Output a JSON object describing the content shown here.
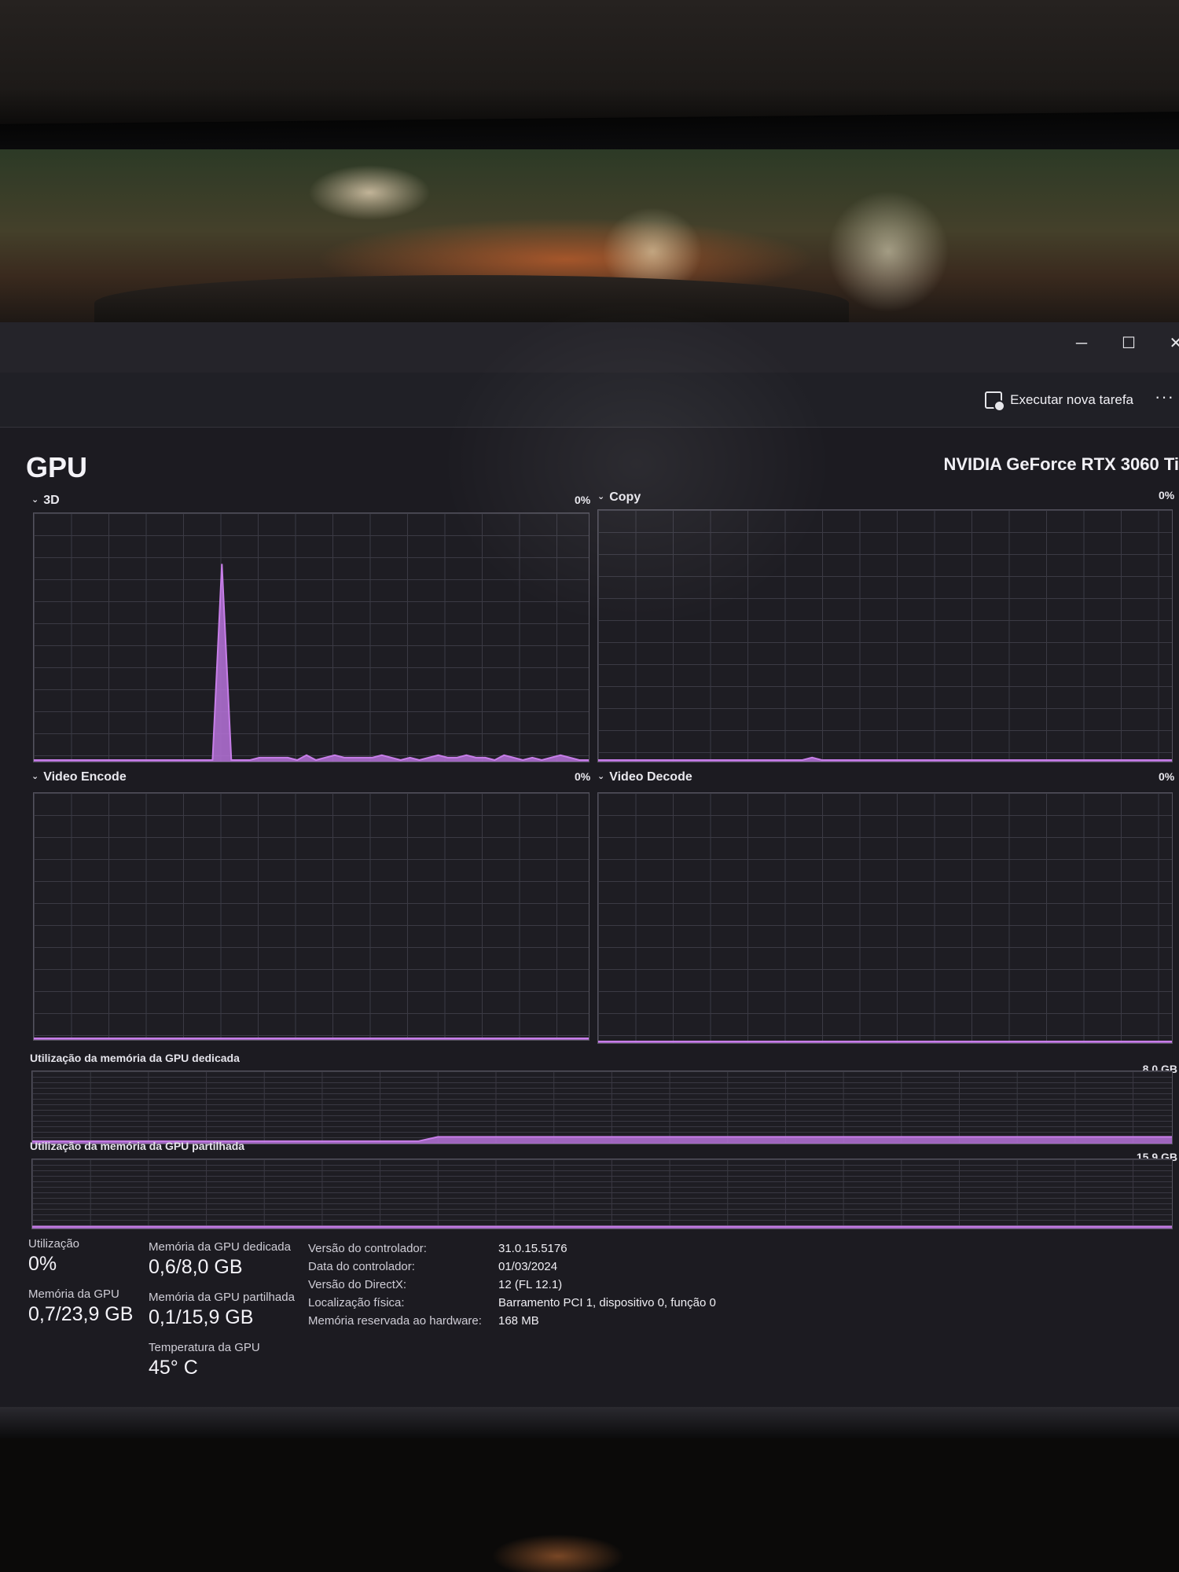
{
  "window": {
    "minimize": "─",
    "maximize": "☐",
    "close": "✕"
  },
  "toolbar": {
    "run_task_label": "Executar nova tarefa",
    "more_label": "···"
  },
  "header": {
    "title": "GPU",
    "device": "NVIDIA GeForce RTX 3060 Ti"
  },
  "engines": [
    {
      "name": "3D",
      "percent": "0%"
    },
    {
      "name": "Copy",
      "percent": "0%"
    },
    {
      "name": "Video Encode",
      "percent": "0%"
    },
    {
      "name": "Video Decode",
      "percent": "0%"
    }
  ],
  "memory_graphs": {
    "dedicated_label": "Utilização da memória da GPU dedicada",
    "dedicated_max": "8,0 GB",
    "shared_label": "Utilização da memória da GPU partilhada",
    "shared_max": "15,9 GB"
  },
  "stats": {
    "utilization_label": "Utilização",
    "utilization_value": "0%",
    "gpu_memory_label": "Memória da GPU",
    "gpu_memory_value": "0,7/23,9 GB",
    "dedicated_label": "Memória da GPU dedicada",
    "dedicated_value": "0,6/8,0 GB",
    "shared_label": "Memória da GPU partilhada",
    "shared_value": "0,1/15,9 GB",
    "temp_label": "Temperatura da GPU",
    "temp_value": "45° C"
  },
  "properties": [
    {
      "label": "Versão do controlador:",
      "value": "31.0.15.5176"
    },
    {
      "label": "Data do controlador:",
      "value": "01/03/2024"
    },
    {
      "label": "Versão do DirectX:",
      "value": "12 (FL 12.1)"
    },
    {
      "label": "Localização física:",
      "value": "Barramento PCI 1, dispositivo 0, função 0"
    },
    {
      "label": "Memória reservada ao hardware:",
      "value": "168 MB"
    }
  ],
  "colors": {
    "accent": "#c77ee8",
    "accent_fill": "#b672d9",
    "background": "#1c1b21",
    "grid": "#3b3a44"
  },
  "icons": {
    "run_task": "run-task-icon",
    "chevron": "chevron-down-icon"
  },
  "chart_data": [
    {
      "type": "area",
      "name": "3D",
      "ylim": [
        0,
        100
      ],
      "samples": 60,
      "values": [
        0,
        0,
        0,
        0,
        0,
        0,
        0,
        0,
        0,
        0,
        0,
        0,
        0,
        0,
        0,
        0,
        0,
        0,
        0,
        0,
        80,
        0,
        0,
        0,
        1,
        1,
        1,
        1,
        0,
        2,
        0,
        1,
        2,
        1,
        1,
        1,
        1,
        2,
        1,
        0,
        1,
        0,
        1,
        2,
        1,
        1,
        2,
        1,
        1,
        0,
        2,
        1,
        0,
        1,
        0,
        1,
        2,
        1,
        0,
        0
      ]
    },
    {
      "type": "area",
      "name": "Copy",
      "ylim": [
        0,
        100
      ],
      "samples": 60,
      "values": [
        0,
        0,
        0,
        0,
        0,
        0,
        0,
        0,
        0,
        0,
        0,
        0,
        0,
        0,
        0,
        0,
        0,
        0,
        0,
        0,
        0,
        0,
        1,
        0,
        0,
        0,
        0,
        0,
        0,
        0,
        0,
        0,
        0,
        0,
        0,
        0,
        0,
        0,
        0,
        0,
        0,
        0,
        0,
        0,
        0,
        0,
        0,
        0,
        0,
        0,
        0,
        0,
        0,
        0,
        0,
        0,
        0,
        0,
        0,
        0
      ]
    },
    {
      "type": "area",
      "name": "Video Encode",
      "ylim": [
        0,
        100
      ],
      "samples": 60,
      "values": [
        0,
        0,
        0,
        0,
        0,
        0,
        0,
        0,
        0,
        0,
        0,
        0,
        0,
        0,
        0,
        0,
        0,
        0,
        0,
        0,
        0,
        0,
        0,
        0,
        0,
        0,
        0,
        0,
        0,
        0,
        0,
        0,
        0,
        0,
        0,
        0,
        0,
        0,
        0,
        0,
        0,
        0,
        0,
        0,
        0,
        0,
        0,
        0,
        0,
        0,
        0,
        0,
        0,
        0,
        0,
        0,
        0,
        0,
        0,
        0
      ]
    },
    {
      "type": "area",
      "name": "Video Decode",
      "ylim": [
        0,
        100
      ],
      "samples": 60,
      "values": [
        0,
        0,
        0,
        0,
        0,
        0,
        0,
        0,
        0,
        0,
        0,
        0,
        0,
        0,
        0,
        0,
        0,
        0,
        0,
        0,
        0,
        0,
        0,
        0,
        0,
        0,
        0,
        0,
        0,
        0,
        0,
        0,
        0,
        0,
        0,
        0,
        0,
        0,
        0,
        0,
        0,
        0,
        0,
        0,
        0,
        0,
        0,
        0,
        0,
        0,
        0,
        0,
        0,
        0,
        0,
        0,
        0,
        0,
        0,
        0
      ]
    },
    {
      "type": "area",
      "name": "Utilização da memória da GPU dedicada",
      "ylim": [
        0,
        8.0
      ],
      "samples": 60,
      "values": [
        0.1,
        0.1,
        0.1,
        0.1,
        0.1,
        0.1,
        0.1,
        0.1,
        0.1,
        0.1,
        0.1,
        0.1,
        0.1,
        0.1,
        0.1,
        0.1,
        0.1,
        0.1,
        0.1,
        0.1,
        0.1,
        0.6,
        0.6,
        0.6,
        0.6,
        0.6,
        0.6,
        0.6,
        0.6,
        0.6,
        0.6,
        0.6,
        0.6,
        0.6,
        0.6,
        0.6,
        0.6,
        0.6,
        0.6,
        0.6,
        0.6,
        0.6,
        0.6,
        0.6,
        0.6,
        0.6,
        0.6,
        0.6,
        0.6,
        0.6,
        0.6,
        0.6,
        0.6,
        0.6,
        0.6,
        0.6,
        0.6,
        0.6,
        0.6,
        0.6
      ]
    },
    {
      "type": "area",
      "name": "Utilização da memória da GPU partilhada",
      "ylim": [
        0,
        15.9
      ],
      "samples": 60,
      "values": [
        0.1,
        0.1,
        0.1,
        0.1,
        0.1,
        0.1,
        0.1,
        0.1,
        0.1,
        0.1,
        0.1,
        0.1,
        0.1,
        0.1,
        0.1,
        0.1,
        0.1,
        0.1,
        0.1,
        0.1,
        0.1,
        0.1,
        0.1,
        0.1,
        0.1,
        0.1,
        0.1,
        0.1,
        0.1,
        0.1,
        0.1,
        0.1,
        0.1,
        0.1,
        0.1,
        0.1,
        0.1,
        0.1,
        0.1,
        0.1,
        0.1,
        0.1,
        0.1,
        0.1,
        0.1,
        0.1,
        0.1,
        0.1,
        0.1,
        0.1,
        0.1,
        0.1,
        0.1,
        0.1,
        0.1,
        0.1,
        0.1,
        0.1,
        0.1,
        0.1
      ]
    }
  ]
}
